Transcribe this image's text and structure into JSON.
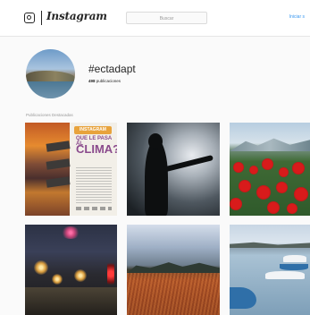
{
  "header": {
    "wordmark": "Instagram",
    "search_placeholder": "Buscar",
    "login_label": "Iniciar s"
  },
  "profile": {
    "hashtag": "#ectadapt",
    "count_value": "498",
    "count_label": "publicaciones"
  },
  "section": {
    "label": "Publicaciones Destacadas"
  },
  "poster": {
    "badge": "INSTAGRAM",
    "line1": "QUE LE PASA AL",
    "line2": "CLIMA?"
  },
  "colors": {
    "link": "#3897f0",
    "background": "#fafafa",
    "text": "#262626"
  },
  "icons": [
    "instagram-camera-icon"
  ]
}
